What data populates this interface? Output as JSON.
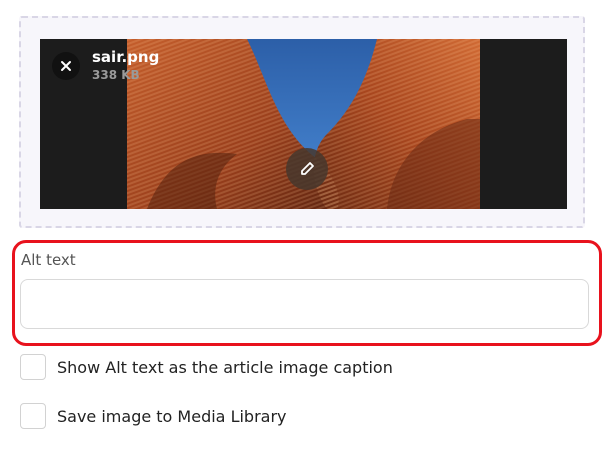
{
  "upload": {
    "file_name": "sair.png",
    "file_size": "338 KB",
    "remove_icon": "close-icon",
    "edit_icon": "pencil-icon"
  },
  "alt_text": {
    "label": "Alt text",
    "value": "",
    "placeholder": ""
  },
  "options": [
    {
      "label": "Show Alt text as the article image caption",
      "checked": false
    },
    {
      "label": "Save image to Media Library",
      "checked": false
    }
  ],
  "colors": {
    "highlight_border": "#e8121d",
    "dropzone_border": "#d9d6e6",
    "sky": "#3a77c4",
    "brick": "#b4552a"
  }
}
